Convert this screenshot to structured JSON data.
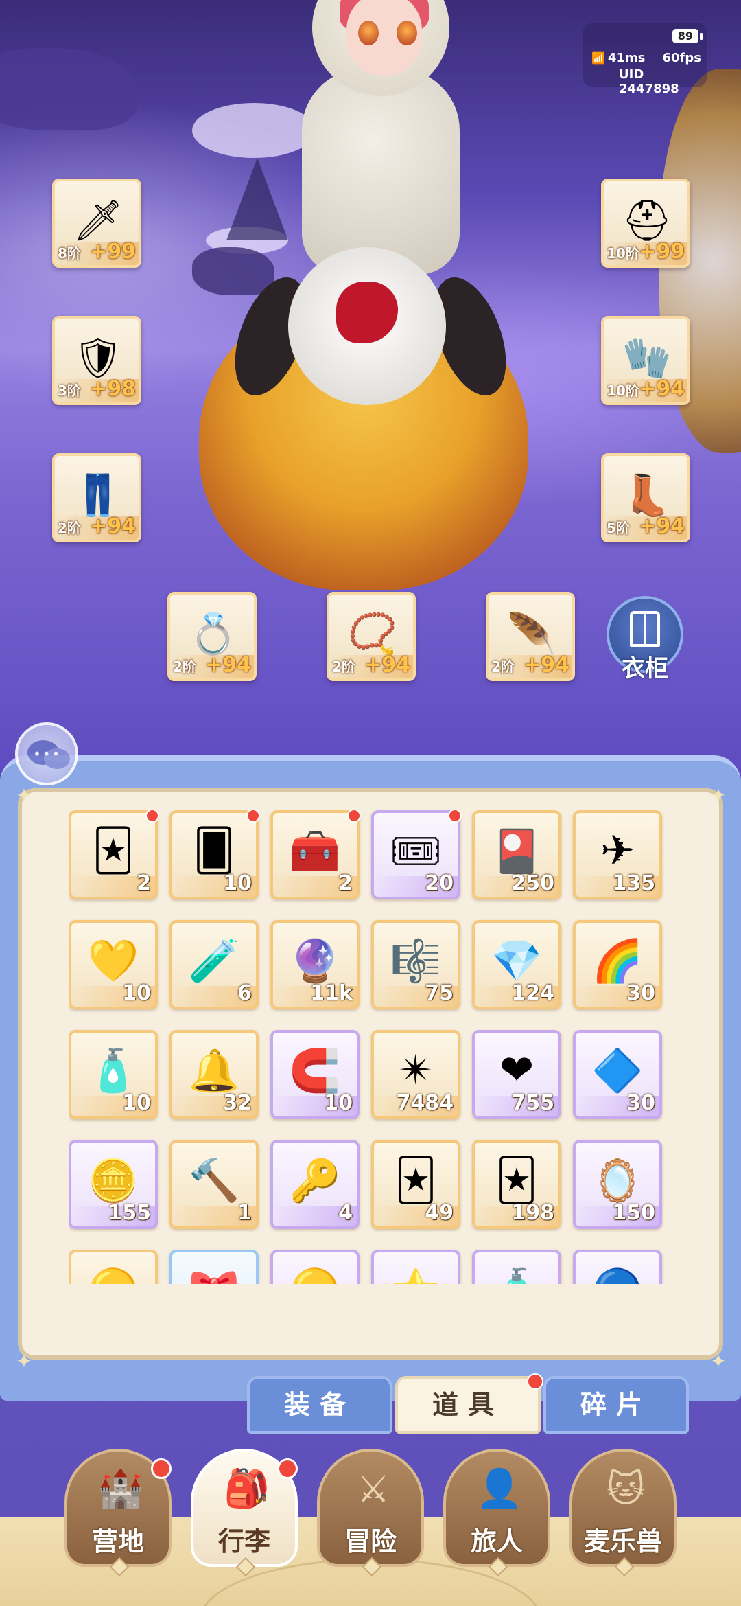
{
  "hud": {
    "ping": "41ms",
    "fps": "60fps",
    "uid": "UID 2447898",
    "battery": "89"
  },
  "equipment": {
    "weapon": {
      "icon": "sword-icon",
      "glyph": "🗡",
      "tier": "8阶",
      "bonus": "+99"
    },
    "helmet": {
      "icon": "helmet-icon",
      "glyph": "⛑",
      "tier": "10阶",
      "bonus": "+99"
    },
    "armor": {
      "icon": "armor-icon",
      "glyph": "🛡",
      "tier": "3阶",
      "bonus": "+98"
    },
    "gloves": {
      "icon": "gauntlet-icon",
      "glyph": "🧤",
      "tier": "10阶",
      "bonus": "+94"
    },
    "pants": {
      "icon": "pants-icon",
      "glyph": "👖",
      "tier": "2阶",
      "bonus": "+94"
    },
    "boots": {
      "icon": "boots-icon",
      "glyph": "👢",
      "tier": "5阶",
      "bonus": "+94"
    },
    "ring": {
      "icon": "ring-icon",
      "glyph": "💍",
      "tier": "2阶",
      "bonus": "+94"
    },
    "necklace": {
      "icon": "necklace-icon",
      "glyph": "📿",
      "tier": "2阶",
      "bonus": "+94"
    },
    "charm": {
      "icon": "charm-icon",
      "glyph": "🪶",
      "tier": "2阶",
      "bonus": "+94"
    }
  },
  "wardrobe": {
    "label": "衣柜",
    "icon": "wardrobe-icon"
  },
  "inventory": {
    "items": [
      {
        "icon": "gold-eye-card-icon",
        "glyph": "🃏",
        "count": "2",
        "rarity": "gold",
        "new": true
      },
      {
        "icon": "red-eye-card-icon",
        "glyph": "🂠",
        "count": "10",
        "rarity": "gold",
        "new": true
      },
      {
        "icon": "treasure-chest-icon",
        "glyph": "🧰",
        "count": "2",
        "rarity": "gold",
        "new": true
      },
      {
        "icon": "purple-ticket-icon",
        "glyph": "🎟",
        "count": "20",
        "rarity": "purple",
        "new": true
      },
      {
        "icon": "purple-card-icon",
        "glyph": "🎴",
        "count": "250",
        "rarity": "gold",
        "new": false
      },
      {
        "icon": "paper-plane-icon",
        "glyph": "✈",
        "count": "135",
        "rarity": "gold",
        "new": false
      },
      {
        "icon": "gold-crystal-icon",
        "glyph": "💛",
        "count": "10",
        "rarity": "gold",
        "new": false
      },
      {
        "icon": "blue-potion-icon",
        "glyph": "🧪",
        "count": "6",
        "rarity": "gold",
        "new": false
      },
      {
        "icon": "rune-orb-icon",
        "glyph": "🔮",
        "count": "11k",
        "rarity": "gold",
        "new": false
      },
      {
        "icon": "lyre-icon",
        "glyph": "🎼",
        "count": "75",
        "rarity": "gold",
        "new": false
      },
      {
        "icon": "ice-crystal-icon",
        "glyph": "💎",
        "count": "124",
        "rarity": "gold",
        "new": false
      },
      {
        "icon": "rainbow-paint-icon",
        "glyph": "🌈",
        "count": "30",
        "rarity": "gold",
        "new": false
      },
      {
        "icon": "rainbow-bottle-icon",
        "glyph": "🧴",
        "count": "10",
        "rarity": "gold",
        "new": false
      },
      {
        "icon": "bell-icon",
        "glyph": "🔔",
        "count": "32",
        "rarity": "gold",
        "new": false
      },
      {
        "icon": "horseshoe-icon",
        "glyph": "🧲",
        "count": "10",
        "rarity": "purple",
        "new": false
      },
      {
        "icon": "star-crystal-icon",
        "glyph": "✴",
        "count": "7484",
        "rarity": "gold",
        "new": false
      },
      {
        "icon": "heart-icon",
        "glyph": "❤",
        "count": "755",
        "rarity": "purple",
        "new": false
      },
      {
        "icon": "purple-gem-icon",
        "glyph": "🔷",
        "count": "30",
        "rarity": "purple",
        "new": false
      },
      {
        "icon": "heart-coin-icon",
        "glyph": "🪙",
        "count": "155",
        "rarity": "purple",
        "new": false
      },
      {
        "icon": "crystal-hammer-icon",
        "glyph": "🔨",
        "count": "1",
        "rarity": "gold",
        "new": false
      },
      {
        "icon": "gold-key-icon",
        "glyph": "🔑",
        "count": "4",
        "rarity": "purple",
        "new": false
      },
      {
        "icon": "blue-eye-card-icon",
        "glyph": "🃏",
        "count": "49",
        "rarity": "gold",
        "new": false
      },
      {
        "icon": "gold-eye-card-icon",
        "glyph": "🃏",
        "count": "198",
        "rarity": "gold",
        "new": false
      },
      {
        "icon": "cat-mirror-icon",
        "glyph": "🪞",
        "count": "150",
        "rarity": "purple",
        "new": false
      },
      {
        "icon": "partial-item-icon",
        "glyph": "🟡",
        "count": "",
        "rarity": "gold",
        "new": false
      },
      {
        "icon": "partial-item-icon",
        "glyph": "🎀",
        "count": "",
        "rarity": "blue",
        "new": false
      },
      {
        "icon": "partial-item-icon",
        "glyph": "🟡",
        "count": "",
        "rarity": "purple",
        "new": false
      },
      {
        "icon": "partial-item-icon",
        "glyph": "⭐",
        "count": "",
        "rarity": "purple",
        "new": false
      },
      {
        "icon": "partial-item-icon",
        "glyph": "🧴",
        "count": "",
        "rarity": "purple",
        "new": false
      },
      {
        "icon": "partial-item-icon",
        "glyph": "🔵",
        "count": "",
        "rarity": "purple",
        "new": false
      }
    ]
  },
  "tabs": [
    {
      "label": "装备",
      "active": false,
      "badge": false
    },
    {
      "label": "道具",
      "active": true,
      "badge": true
    },
    {
      "label": "碎片",
      "active": false,
      "badge": false
    }
  ],
  "nav": [
    {
      "label": "营地",
      "icon": "castle-icon",
      "glyph": "🏰",
      "active": false,
      "badge": true
    },
    {
      "label": "行李",
      "icon": "backpack-icon",
      "glyph": "🎒",
      "active": true,
      "badge": true
    },
    {
      "label": "冒险",
      "icon": "crossed-swords-icon",
      "glyph": "⚔",
      "active": false,
      "badge": false
    },
    {
      "label": "旅人",
      "icon": "traveler-icon",
      "glyph": "👤",
      "active": false,
      "badge": false
    },
    {
      "label": "麦乐兽",
      "icon": "cat-icon",
      "glyph": "🐱",
      "active": false,
      "badge": false
    }
  ],
  "colors": {
    "badge": "#f0473b",
    "gold_border": "#f5c87b",
    "purple_border": "#c7a9f0",
    "panel_blue": "#8aa8e6"
  }
}
